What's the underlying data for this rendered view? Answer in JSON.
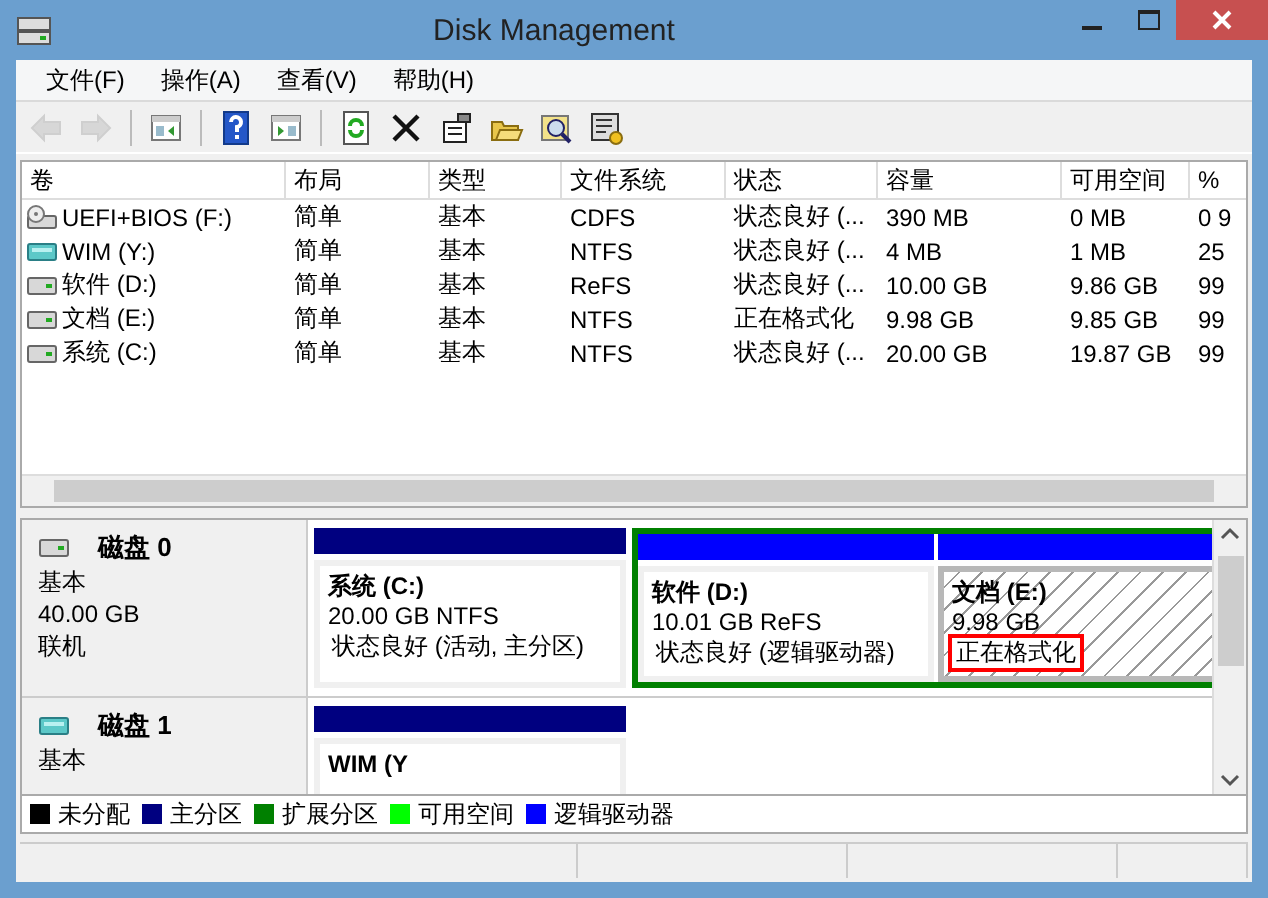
{
  "window": {
    "title": "Disk Management"
  },
  "menu": [
    "文件(F)",
    "操作(A)",
    "查看(V)",
    "帮助(H)"
  ],
  "toolbar": [
    {
      "kind": "back",
      "disabled": true
    },
    {
      "kind": "forward",
      "disabled": true
    },
    {
      "kind": "sep"
    },
    {
      "kind": "tree",
      "disabled": false
    },
    {
      "kind": "sep"
    },
    {
      "kind": "help",
      "disabled": false
    },
    {
      "kind": "pane",
      "disabled": false
    },
    {
      "kind": "sep"
    },
    {
      "kind": "refresh",
      "disabled": false
    },
    {
      "kind": "delete",
      "disabled": false
    },
    {
      "kind": "properties",
      "disabled": false
    },
    {
      "kind": "open",
      "disabled": false
    },
    {
      "kind": "find",
      "disabled": false
    },
    {
      "kind": "settings",
      "disabled": false
    }
  ],
  "table": {
    "columns": [
      "卷",
      "布局",
      "类型",
      "文件系统",
      "状态",
      "容量",
      "可用空间",
      "%"
    ],
    "rows": [
      {
        "kind": "optical",
        "cells": [
          "UEFI+BIOS (F:)",
          "简单",
          "基本",
          "CDFS",
          "状态良好 (...",
          "390 MB",
          "0 MB",
          "0 9"
        ]
      },
      {
        "kind": "usb",
        "cells": [
          "WIM (Y:)",
          "简单",
          "基本",
          "NTFS",
          "状态良好 (...",
          "4 MB",
          "1 MB",
          "25"
        ]
      },
      {
        "kind": "disk",
        "cells": [
          "软件 (D:)",
          "简单",
          "基本",
          "ReFS",
          "状态良好 (...",
          "10.00 GB",
          "9.86 GB",
          "99"
        ]
      },
      {
        "kind": "disk",
        "cells": [
          "文档 (E:)",
          "简单",
          "基本",
          "NTFS",
          "正在格式化",
          "9.98 GB",
          "9.85 GB",
          "99"
        ]
      },
      {
        "kind": "disk",
        "cells": [
          "系统 (C:)",
          "简单",
          "基本",
          "NTFS",
          "状态良好 (...",
          "20.00 GB",
          "19.87 GB",
          "99"
        ]
      }
    ]
  },
  "disks": [
    {
      "kind": "disk",
      "name": "磁盘 0",
      "type": "基本",
      "size": "40.00 GB",
      "state": "联机",
      "partitions": [
        {
          "kind": "primary",
          "name": "系统  (C:)",
          "size": "20.00 GB NTFS",
          "status": "状态良好 (活动, 主分区)",
          "selected": false,
          "status_marked": false
        },
        {
          "kind": "extended",
          "children": [
            {
              "kind": "logical",
              "name": "软件  (D:)",
              "size": "10.01 GB ReFS",
              "status": "状态良好 (逻辑驱动器)",
              "selected": false,
              "status_marked": false
            },
            {
              "kind": "logical",
              "name": "文档  (E:)",
              "size": "9.98 GB",
              "status": "正在格式化",
              "selected": true,
              "status_marked": true
            }
          ]
        }
      ]
    },
    {
      "kind": "usb",
      "name": "磁盘 1",
      "type": "基本",
      "partitions": [
        {
          "kind": "primary",
          "name": "WIM  (Y",
          "selected": false
        }
      ]
    }
  ],
  "legend": [
    {
      "label": "未分配",
      "color": "#000000"
    },
    {
      "label": "主分区",
      "color": "#000080"
    },
    {
      "label": "扩展分区",
      "color": "#008000"
    },
    {
      "label": "可用空间",
      "color": "#00ff00"
    },
    {
      "label": "逻辑驱动器",
      "color": "#0000ff"
    }
  ]
}
